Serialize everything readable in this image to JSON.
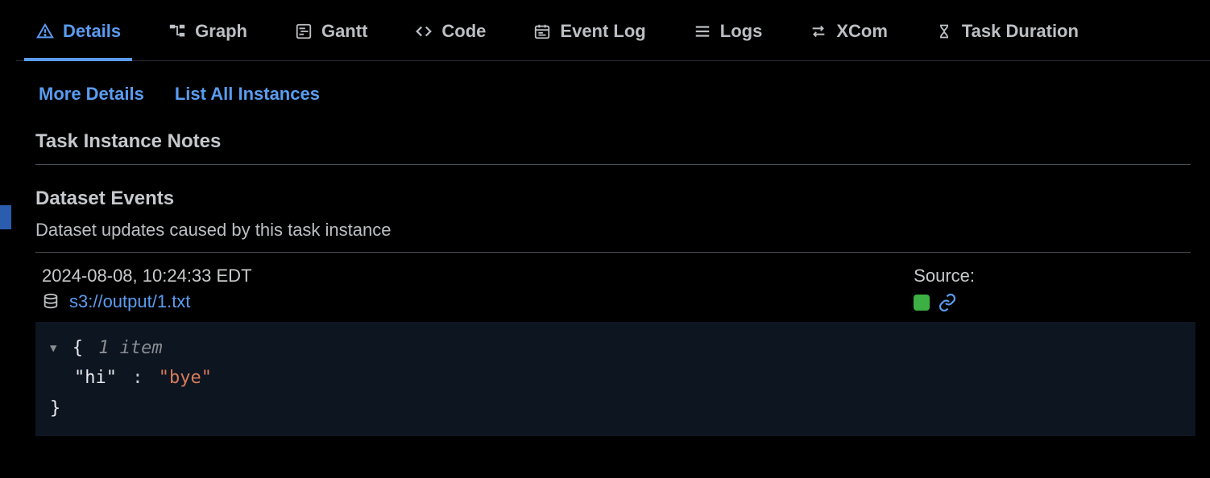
{
  "tabs": [
    {
      "label": "Details"
    },
    {
      "label": "Graph"
    },
    {
      "label": "Gantt"
    },
    {
      "label": "Code"
    },
    {
      "label": "Event Log"
    },
    {
      "label": "Logs"
    },
    {
      "label": "XCom"
    },
    {
      "label": "Task Duration"
    }
  ],
  "sublinks": {
    "more_details": "More Details",
    "list_all": "List All Instances"
  },
  "sections": {
    "notes_title": "Task Instance Notes",
    "events_title": "Dataset Events",
    "events_desc": "Dataset updates caused by this task instance"
  },
  "event": {
    "timestamp": "2024-08-08, 10:24:33 EDT",
    "dataset_uri": "s3://output/1.txt",
    "source_label": "Source:"
  },
  "json": {
    "item_count": "1 item",
    "key_display": "\"hi\"",
    "value_display": "\"bye\"",
    "open_brace": "{",
    "close_brace": "}",
    "colon": ":"
  },
  "colors": {
    "accent": "#5a9cf0",
    "status_green": "#3cb043",
    "json_value": "#d87c5a"
  }
}
